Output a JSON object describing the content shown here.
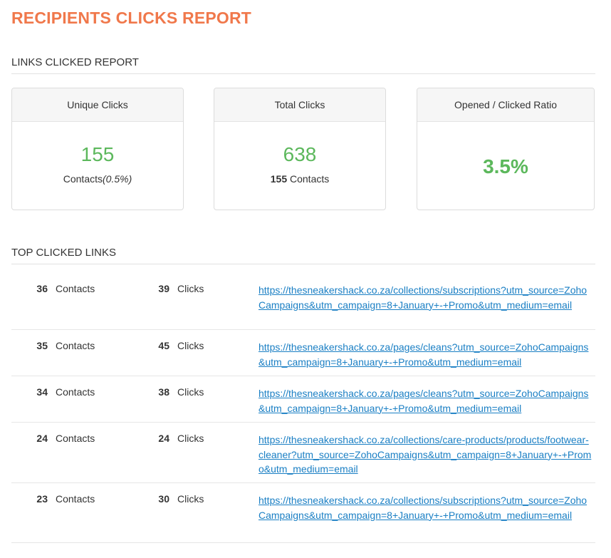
{
  "page": {
    "title": "RECIPIENTS CLICKS REPORT"
  },
  "links_clicked": {
    "heading": "LINKS CLICKED REPORT",
    "cards": [
      {
        "header": "Unique Clicks",
        "value": "155",
        "sub_label": "Contacts",
        "sub_percent": "(0.5%)"
      },
      {
        "header": "Total Clicks",
        "value": "638",
        "sub_count": "155",
        "sub_label": "Contacts"
      },
      {
        "header": "Opened / Clicked Ratio",
        "value": "3.5%"
      }
    ],
    "value_color": "#5cb85c"
  },
  "top_links": {
    "heading": "TOP CLICKED LINKS",
    "contacts_label": "Contacts",
    "clicks_label": "Clicks",
    "rows": [
      {
        "contacts": "36",
        "clicks": "39",
        "url": "https://thesneakershack.co.za/collections/subscriptions?utm_source=ZohoCampaigns&utm_campaign=8+January+-+Promo&utm_medium=email"
      },
      {
        "contacts": "35",
        "clicks": "45",
        "url": "https://thesneakershack.co.za/pages/cleans?utm_source=ZohoCampaigns&utm_campaign=8+January+-+Promo&utm_medium=email"
      },
      {
        "contacts": "34",
        "clicks": "38",
        "url": "https://thesneakershack.co.za/pages/cleans?utm_source=ZohoCampaigns&utm_campaign=8+January+-+Promo&utm_medium=email"
      },
      {
        "contacts": "24",
        "clicks": "24",
        "url": "https://thesneakershack.co.za/collections/care-products/products/footwear-cleaner?utm_source=ZohoCampaigns&utm_campaign=8+January+-+Promo&utm_medium=email"
      },
      {
        "contacts": "23",
        "clicks": "30",
        "url": "https://thesneakershack.co.za/collections/subscriptions?utm_source=ZohoCampaigns&utm_campaign=8+January+-+Promo&utm_medium=email"
      }
    ]
  },
  "colors": {
    "title_accent": "#f0784b",
    "link": "#1a7fc4",
    "positive_value": "#5cb85c"
  }
}
